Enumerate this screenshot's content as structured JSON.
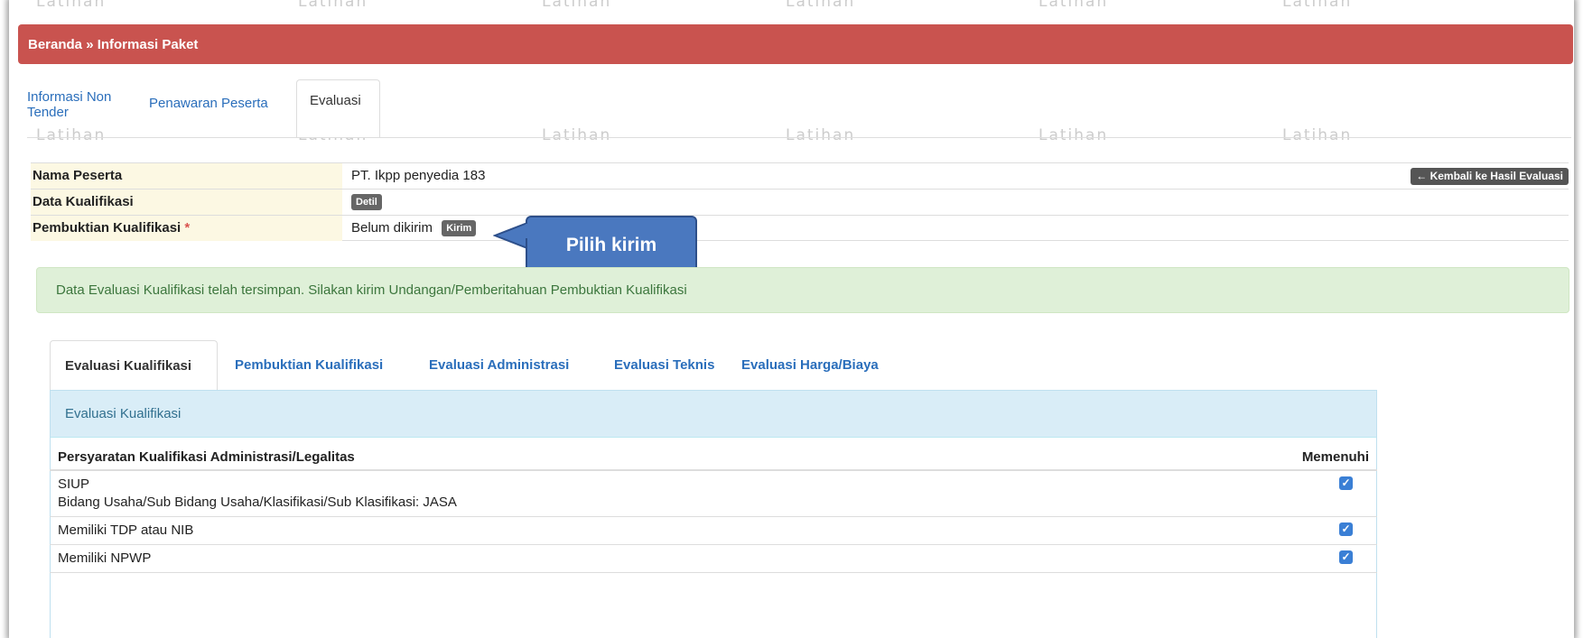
{
  "watermark": {
    "text": "Latihan"
  },
  "breadcrumb": {
    "text": "Beranda » Informasi Paket"
  },
  "top_tabs": [
    {
      "label": "Informasi Non Tender"
    },
    {
      "label": "Penawaran Peserta"
    },
    {
      "label": "Evaluasi"
    }
  ],
  "info": {
    "peserta_label": "Nama Peserta",
    "peserta_value": "PT. Ikpp penyedia 183",
    "back_button": "← Kembali ke Hasil Evaluasi",
    "kualifikasi_label": "Data Kualifikasi",
    "detil_button": "Detil",
    "pembuktian_label": "Pembuktian Kualifikasi",
    "required_mark": "*",
    "pembuktian_status": "Belum dikirim",
    "kirim_button": "Kirim"
  },
  "callout": {
    "text": "Pilih kirim",
    "color": "#4a78bf"
  },
  "alert": {
    "text": "Data Evaluasi Kualifikasi telah tersimpan. Silakan kirim Undangan/Pemberitahuan Pembuktian Kualifikasi"
  },
  "eval_tabs": [
    {
      "label": "Evaluasi Kualifikasi"
    },
    {
      "label": "Pembuktian Kualifikasi"
    },
    {
      "label": "Evaluasi Administrasi"
    },
    {
      "label": "Evaluasi Teknis"
    },
    {
      "label": "Evaluasi Harga/Biaya"
    }
  ],
  "panel": {
    "title": "Evaluasi Kualifikasi"
  },
  "requirements": {
    "header_requirement": "Persyaratan Kualifikasi Administrasi/Legalitas",
    "header_status": "Memenuhi",
    "rows": [
      {
        "line1": "SIUP",
        "line2": "Bidang Usaha/Sub Bidang Usaha/Klasifikasi/Sub Klasifikasi: JASA",
        "checked": true
      },
      {
        "line1": "Memiliki TDP atau NIB",
        "checked": true
      },
      {
        "line1": "Memiliki NPWP",
        "checked": true
      }
    ]
  },
  "colors": {
    "header_bg": "#c9534f",
    "link": "#2a6ebb",
    "alert_bg": "#dff0d8",
    "label_bg": "#fcf8e3",
    "panel_head_bg": "#d9edf7"
  }
}
